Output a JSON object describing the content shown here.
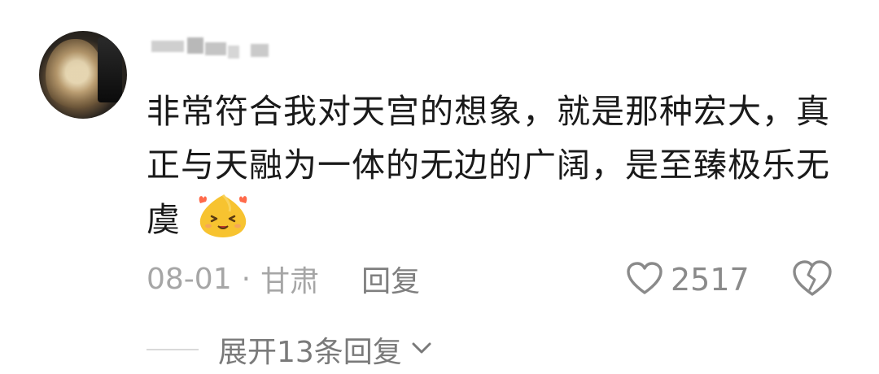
{
  "comment": {
    "text": "非常符合我对天宫的想象，就是那种宏大，真正与天融为一体的无边的广阔，是至臻极乐无虞",
    "emoji": "smiling-emoji-icon",
    "date": "08-01",
    "separator": "·",
    "location": "甘肃",
    "reply_label": "回复",
    "likes": "2517",
    "expand_label": "展开13条回复"
  },
  "colors": {
    "text": "#1a1a1a",
    "meta": "#a6a6a6",
    "icon": "#8a8a8a",
    "emoji": "#f7c330"
  }
}
